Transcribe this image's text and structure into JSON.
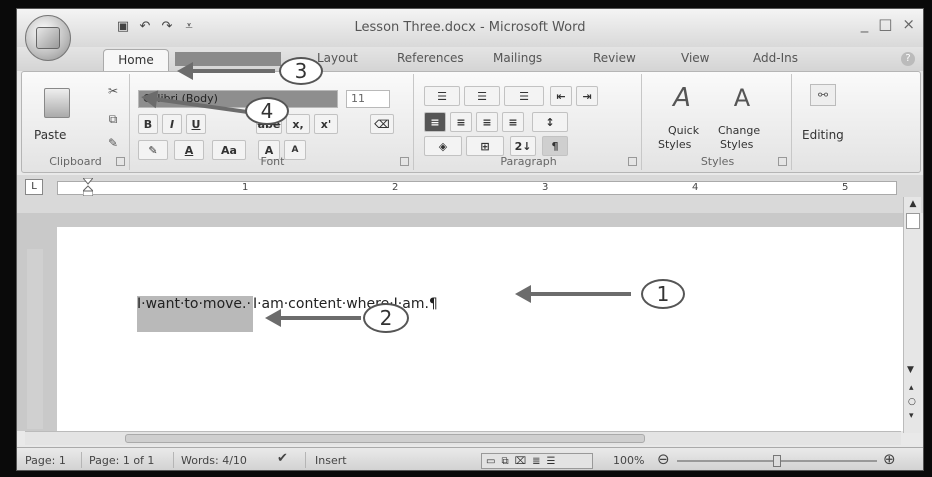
{
  "window": {
    "title": "Lesson Three.docx - Microsoft Word",
    "qat_icons": [
      "save-icon",
      "undo-icon",
      "redo-icon",
      "customize-icon"
    ],
    "controls": [
      "_",
      "□",
      "×"
    ]
  },
  "tabs": [
    {
      "label": "Home"
    },
    {
      "label": "Layout"
    },
    {
      "label": "References"
    },
    {
      "label": "Mailings"
    },
    {
      "label": "Review"
    },
    {
      "label": "View"
    },
    {
      "label": "Add-Ins"
    }
  ],
  "ribbon": {
    "clipboard": {
      "paste_label": "Paste",
      "group_label": "Clipboard"
    },
    "font": {
      "font_name": "Calibri (Body)",
      "font_size": "11",
      "group_label": "Font",
      "bold": "B",
      "italic": "I",
      "underline": "U",
      "strike": "abe",
      "subscript": "x,",
      "superscript": "x'",
      "grow": "A",
      "shrink": "A",
      "case": "Aa"
    },
    "paragraph": {
      "group_label": "Paragraph",
      "sort": "2↓",
      "pilcrow": "¶"
    },
    "styles": {
      "quick_label": "Quick",
      "quick_sub": "Styles",
      "change_label": "Change",
      "change_sub": "Styles",
      "group_label": "Styles"
    },
    "editing": {
      "label": "Editing"
    }
  },
  "ruler": {
    "numbers": [
      "1",
      "2",
      "3",
      "4",
      "5"
    ]
  },
  "document": {
    "selected_text": "I·want·to·move.·",
    "rest_text": "I·am·content·where·I·am.¶"
  },
  "statusbar": {
    "page": "Page: 1",
    "page_of": "Page: 1 of 1",
    "words": "Words: 4/10",
    "insert": "Insert",
    "zoom": "100%"
  },
  "annotations": [
    "1",
    "2",
    "3",
    "4"
  ]
}
